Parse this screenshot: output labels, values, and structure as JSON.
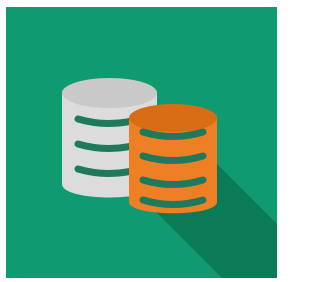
{
  "icon": {
    "name": "database-stacks-icon",
    "colors": {
      "tile_background": "#0f9a6f",
      "long_shadow": "#0b7a57",
      "gray_stack_body": "#dcdcdc",
      "gray_stack_top": "#c9c9c9",
      "gray_stack_lines": "#1f7a5c",
      "orange_stack_body": "#ef7f24",
      "orange_stack_top": "#d96d16",
      "orange_stack_lines": "#1f7a5c",
      "frame": "#ffffff"
    }
  }
}
